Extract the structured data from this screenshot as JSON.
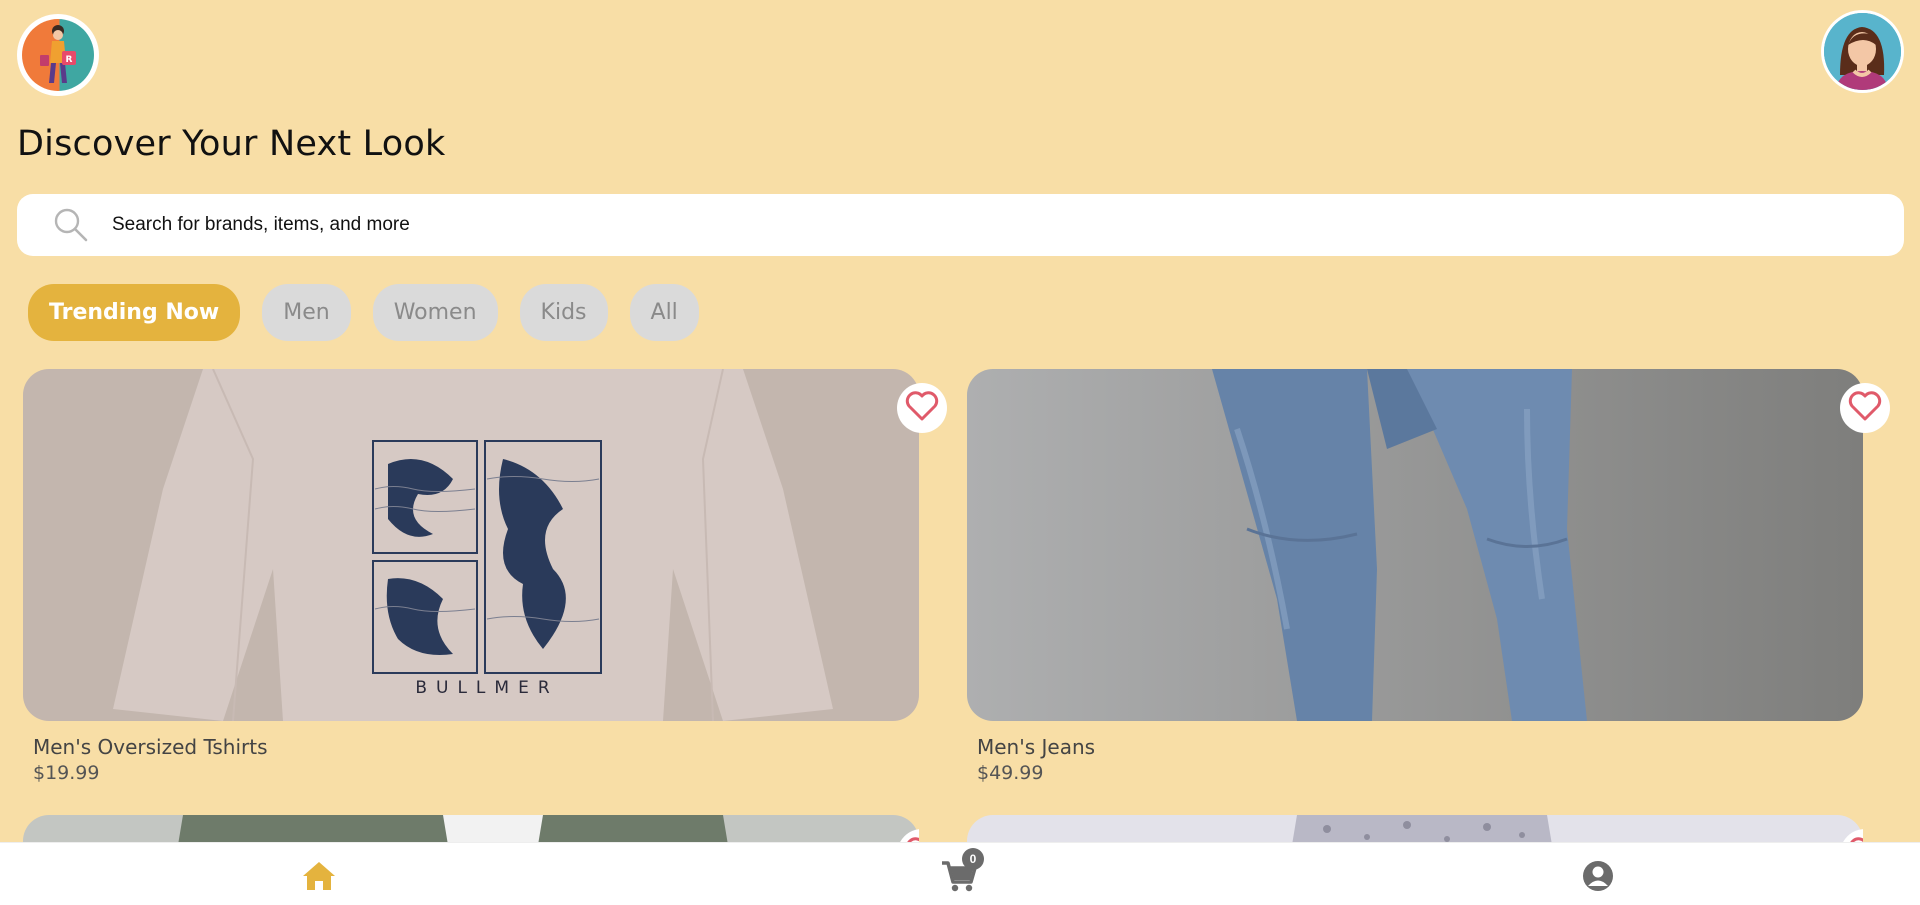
{
  "header": {
    "title": "Discover Your Next Look"
  },
  "search": {
    "placeholder": "Search for brands, items, and more",
    "icon": "search-icon"
  },
  "categories": [
    {
      "label": "Trending Now",
      "active": true
    },
    {
      "label": "Men",
      "active": false
    },
    {
      "label": "Women",
      "active": false
    },
    {
      "label": "Kids",
      "active": false
    },
    {
      "label": "All",
      "active": false
    }
  ],
  "products": [
    {
      "name": "Men's Oversized Tshirts",
      "price": "$19.99",
      "print_text": "BULLMER",
      "favorited": false
    },
    {
      "name": "Men's Jeans",
      "price": "$49.99",
      "favorited": false
    }
  ],
  "bottom_nav": {
    "items": [
      "home-icon",
      "cart-icon",
      "user-circle-icon"
    ],
    "active": "home-icon",
    "cart_count": "0"
  },
  "colors": {
    "background": "#f8dea6",
    "accent": "#e4b33e",
    "chip_inactive": "#dadada",
    "heart": "#e05a6a"
  }
}
